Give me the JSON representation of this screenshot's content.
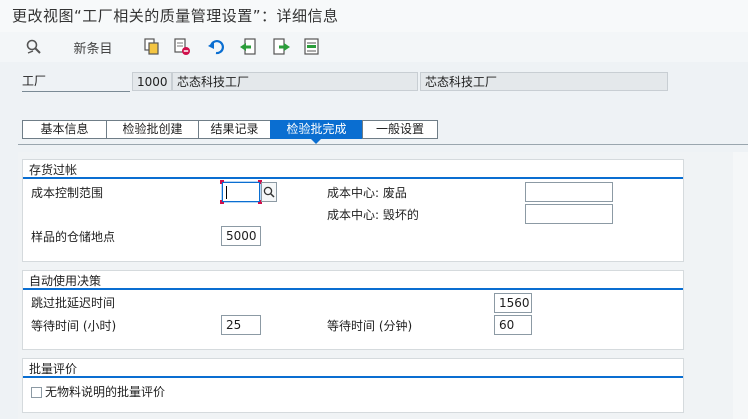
{
  "window": {
    "title": "更改视图“工厂相关的质量管理设置”：详细信息"
  },
  "toolbar": {
    "new_entries_label": "新条目",
    "icons": [
      "display-change-icon",
      "copy-icon",
      "delete-icon",
      "undo-icon",
      "previous-entry-icon",
      "next-entry-icon",
      "select-block-icon"
    ]
  },
  "header": {
    "plant_label": "工厂",
    "plant_code": "1000",
    "plant_name": "芯态科技工厂",
    "plant_name_2": "芯态科技工厂"
  },
  "tabs": [
    {
      "label": "基本信息"
    },
    {
      "label": "检验批创建"
    },
    {
      "label": "结果记录"
    },
    {
      "label": "检验批完成"
    },
    {
      "label": "一般设置"
    }
  ],
  "active_tab": "检验批完成",
  "inventory_posting": {
    "title": "存货过帐",
    "cost_control_area_label": "成本控制范围",
    "cost_control_area_value": "",
    "cost_center_scrap_label": "成本中心: 废品",
    "cost_center_scrap_value": "",
    "cost_center_destroyed_label": "成本中心: 毁坏的",
    "cost_center_destroyed_value": "",
    "sample_storage_label": "样品的仓储地点",
    "sample_storage_value": "5000"
  },
  "auto_usage_decision": {
    "title": "自动使用决策",
    "skip_lot_delay_label": "跳过批延迟时间",
    "skip_lot_delay_value": "1560",
    "wait_hours_label": "等待时间 (小时)",
    "wait_hours_value": "25",
    "wait_minutes_label": "等待时间 (分钟)",
    "wait_minutes_value": "60"
  },
  "batch_valuation": {
    "title": "批量评价",
    "no_material_desc_label": "无物料说明的批量评价",
    "no_material_desc_checked": false
  },
  "colors": {
    "accent": "#0a6ed1",
    "background": "#eef2f5",
    "required": "#d0104c"
  }
}
